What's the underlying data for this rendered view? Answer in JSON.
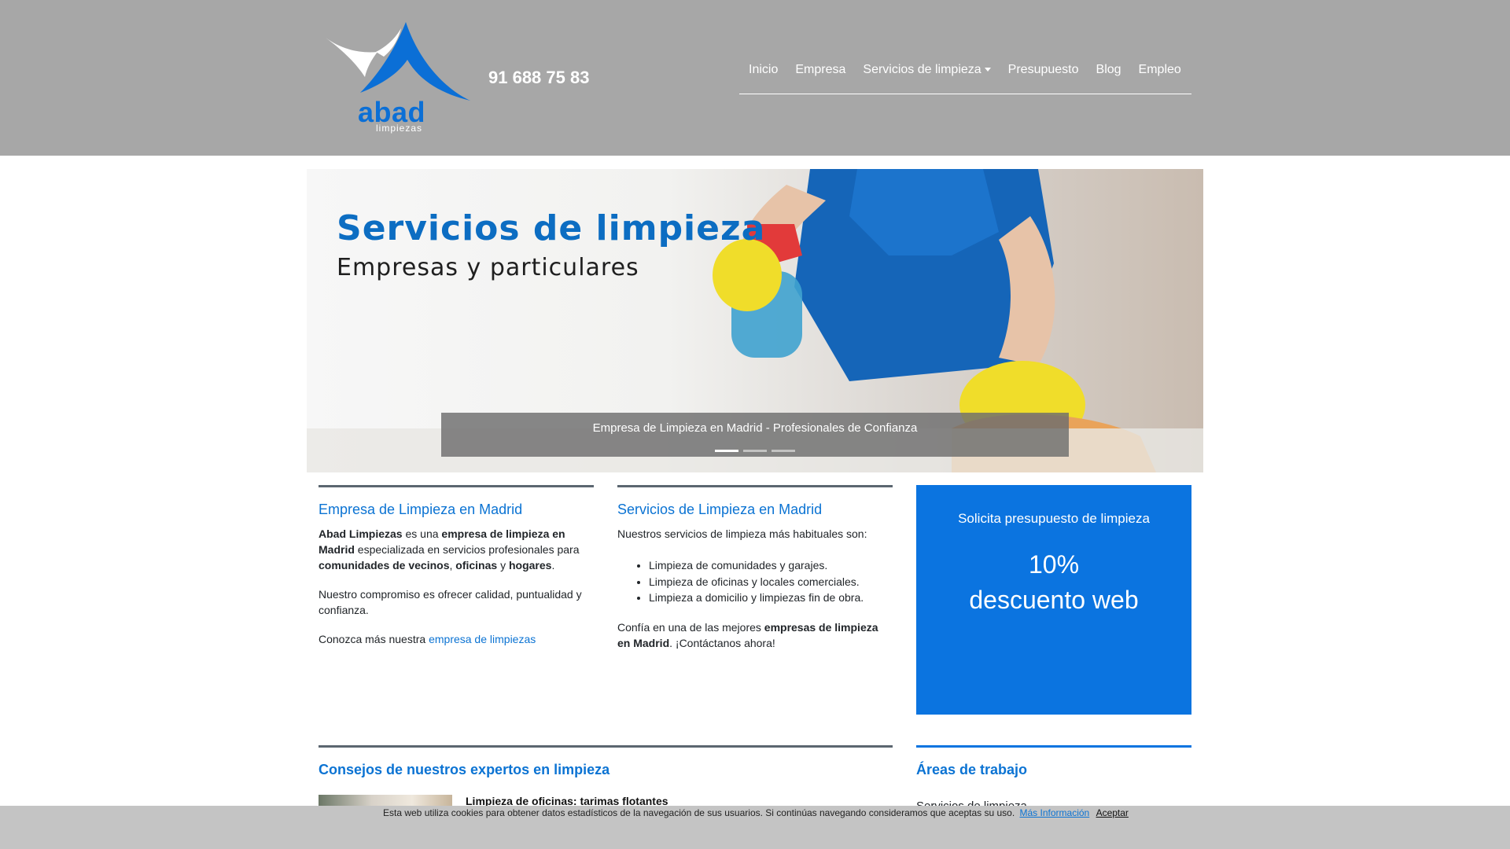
{
  "header": {
    "logo_text": "abad",
    "logo_sub": "limpiezas",
    "phone": "91 688 75 83",
    "nav": [
      {
        "label": "Inicio"
      },
      {
        "label": "Empresa"
      },
      {
        "label": "Servicios de limpieza"
      },
      {
        "label": "Presupuesto"
      },
      {
        "label": "Blog"
      },
      {
        "label": "Empleo"
      }
    ]
  },
  "hero": {
    "title": "Servicios de limpieza",
    "subtitle": "Empresas y particulares",
    "caption": "Empresa de Limpieza en Madrid - Profesionales de Confianza",
    "slides_total": 3,
    "active_slide": 1
  },
  "empresa": {
    "title": "Empresa de Limpieza en Madrid",
    "p1": {
      "a": "Abad Limpiezas",
      "b": " es una ",
      "c": "empresa de limpieza en Madrid",
      "d": " especializada en servicios profesionales para ",
      "e": "comunidades de vecinos",
      "f": ", ",
      "g": "oficinas",
      "h": " y ",
      "i": "hogares",
      "j": "."
    },
    "p2": "Nuestro compromiso es ofrecer calidad, puntualidad y confianza.",
    "p3_prefix": "Conozca más nuestra ",
    "p3_link": "empresa de limpiezas"
  },
  "servicios": {
    "title": "Servicios de Limpieza en Madrid",
    "intro": "Nuestros servicios de limpieza más habituales son:",
    "items": [
      "Limpieza de comunidades y garajes.",
      "Limpieza de oficinas y locales comerciales.",
      "Limpieza a domicilio y limpiezas fin de obra."
    ],
    "closing": {
      "a": "Confía en una de las mejores ",
      "b": "empresas de limpieza en Madrid",
      "c": ". ¡Contáctanos ahora!"
    }
  },
  "promo": {
    "title": "Solicita presupuesto de limpieza",
    "line1": "10%",
    "line2": "descuento web"
  },
  "consejos": {
    "title": "Consejos de nuestros expertos en limpieza",
    "article_title": "Limpieza de oficinas: tarimas flotantes"
  },
  "areas": {
    "title": "Áreas de trabajo",
    "item": "Servicios de limpieza"
  },
  "cookie": {
    "text": "Esta web utiliza cookies para obtener datos estadísticos de la navegación de sus usuarios. Si continúas navegando consideramos que aceptas su uso.",
    "more": "Más Información",
    "accept": "Aceptar"
  },
  "colors": {
    "header_bg": "#a7a7a7",
    "accent": "#0b73d3",
    "promo_bg": "#0b74e0"
  }
}
